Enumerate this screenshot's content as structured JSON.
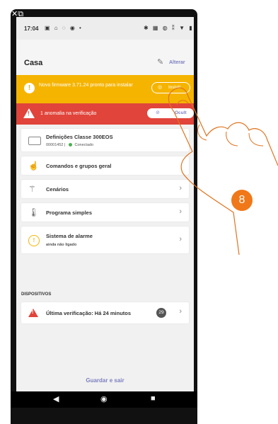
{
  "status_bar": {
    "time": "17:04",
    "left_icons": "▣ ⌂ ◌ ◉ •",
    "right_icons": "✱ ▦ ◍ ⁑ ▼ ▮"
  },
  "header": {
    "title": "Casa",
    "edit_label": "Alterar"
  },
  "firmware_banner": {
    "text": "Novo firmware 3.71.24 pronto para instalar",
    "button_label": "Install"
  },
  "anomaly_banner": {
    "text": "1 anomalia na verificação",
    "button_label": "Ocult"
  },
  "device_card": {
    "label": "Definições Classe 300EOS",
    "serial": "00001452",
    "status": "Conectado"
  },
  "menu": [
    {
      "label": "Comandos e grupos geral"
    },
    {
      "label": "Cenários"
    },
    {
      "label": "Programa simples"
    }
  ],
  "alarm": {
    "label": "Sistema de alarme",
    "sub": "ainda não ligado"
  },
  "devices_section": {
    "title": "DISPOSITIVOS",
    "check_label": "Última verificação: Há 24 minutos",
    "count": "29"
  },
  "save_label": "Guardar e sair",
  "step_number": "8",
  "colors": {
    "accent": "#7d7fc0",
    "warning": "#f5b400",
    "error": "#e0443a",
    "step": "#f07818"
  }
}
